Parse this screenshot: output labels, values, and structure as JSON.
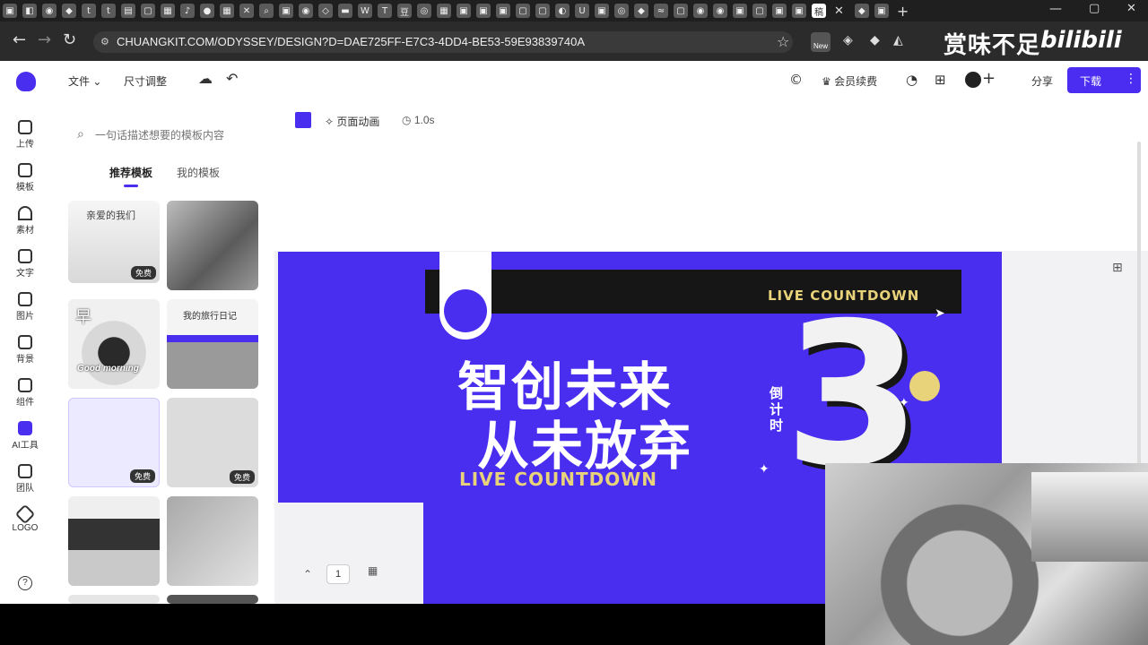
{
  "browser": {
    "url": "CHUANGKIT.COM/ODYSSEY/DESIGN?D=DAE725FF-E7C3-4DD4-BE53-59E93839740A",
    "new_badge": "New"
  },
  "watermark": {
    "text": "赏味不足",
    "logo": "bilibili"
  },
  "toolbar": {
    "file_label": "文件",
    "resize_label": "尺寸调整",
    "member_label": "会员续费",
    "share_label": "分享",
    "download_label": "下载"
  },
  "rail": [
    {
      "label": "上传",
      "icon": "upload-icon"
    },
    {
      "label": "模板",
      "icon": "template-icon"
    },
    {
      "label": "素材",
      "icon": "material-icon"
    },
    {
      "label": "文字",
      "icon": "text-icon"
    },
    {
      "label": "图片",
      "icon": "image-icon"
    },
    {
      "label": "背景",
      "icon": "background-icon"
    },
    {
      "label": "组件",
      "icon": "component-icon"
    },
    {
      "label": "AI工具",
      "icon": "ai-icon"
    },
    {
      "label": "团队",
      "icon": "team-icon"
    },
    {
      "label": "LOGO",
      "icon": "logo-icon"
    }
  ],
  "panel": {
    "search_placeholder": "一句话描述想要的模板内容",
    "tabs": [
      "推荐模板",
      "我的模板"
    ],
    "free_label": "免费",
    "thumb_texts": [
      "亲爱的我们",
      "早",
      "我的旅行日记",
      "Good morning"
    ]
  },
  "canvas_toolbar": {
    "animation_label": "页面动画",
    "duration": "1.0s"
  },
  "design": {
    "title_line1": "智创未来",
    "title_line2": "从未放弃",
    "subtitle": "LIVE COUNTDOWN",
    "banner_text": "LIVE COUNTDOWN",
    "side_text": "倒计时",
    "big_number": "3"
  },
  "pager": {
    "page": "1"
  },
  "colors": {
    "accent": "#4a2ef0",
    "button": "#4b2df2",
    "yellow": "#e8d27a"
  }
}
